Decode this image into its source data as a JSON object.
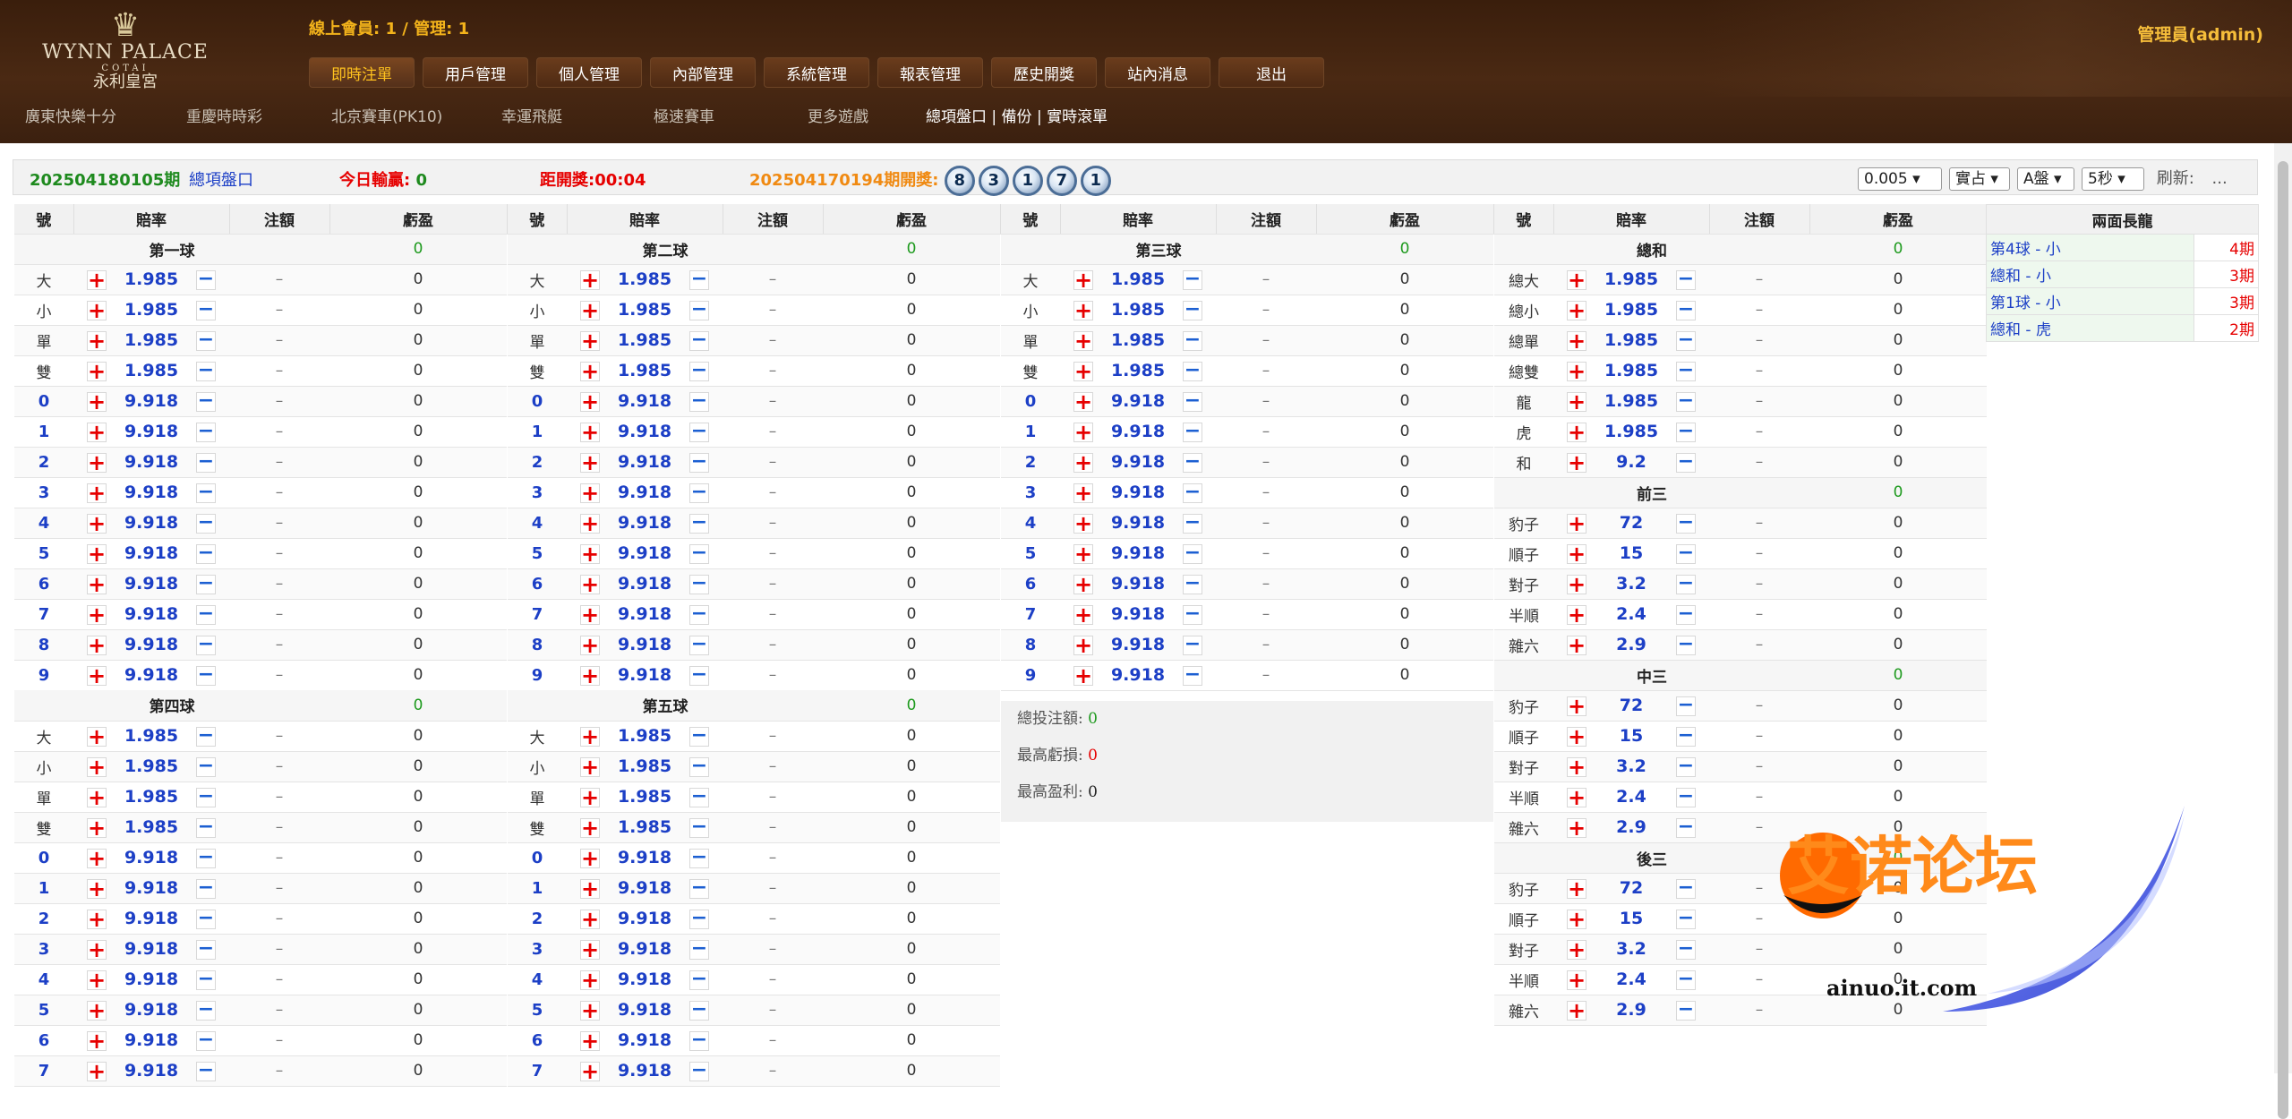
{
  "header": {
    "logo": {
      "name": "WYNN PALACE",
      "sub": "COTAI",
      "cn": "永利皇宮"
    },
    "online_label": "線上會員: ",
    "online_members": "1",
    "sep": " / 管理: ",
    "online_admins": "1",
    "admin": "管理員(admin)",
    "nav": [
      "即時注單",
      "用戶管理",
      "個人管理",
      "內部管理",
      "系統管理",
      "報表管理",
      "歷史開獎",
      "站內消息",
      "退出"
    ],
    "games": [
      "廣東快樂十分",
      "重慶時時彩",
      "北京賽車(PK10)",
      "幸運飛艇",
      "極速賽車",
      "更多遊戲"
    ],
    "sub_links": [
      "總項盤口",
      "備份",
      "實時滾單"
    ]
  },
  "topbar": {
    "period": "202504180105期",
    "panel_link": "總項盤口",
    "profit_label": "今日輸贏:",
    "profit_value": "0",
    "countdown_label": "距開獎:",
    "countdown_value": "00:04",
    "last_period": "202504170194期開獎:",
    "balls": [
      "8",
      "3",
      "1",
      "7",
      "1"
    ],
    "sel_amount": "0.005",
    "sel_type": "實占",
    "sel_panel": "A盤",
    "sel_interval": "5秒",
    "refresh_label": "刷新:",
    "refresh_value": "..."
  },
  "columns": {
    "no": "號",
    "odds": "賠率",
    "bet": "注額",
    "pl": "虧盈"
  },
  "dash": "–",
  "zero": "0",
  "balls_sections": {
    "b1": "第一球",
    "b2": "第二球",
    "b3": "第三球",
    "b4": "第四球",
    "b5": "第五球"
  },
  "ball_rows": [
    {
      "l": "大",
      "o": "1.985",
      "t": "cn"
    },
    {
      "l": "小",
      "o": "1.985",
      "t": "cn"
    },
    {
      "l": "單",
      "o": "1.985",
      "t": "cn"
    },
    {
      "l": "雙",
      "o": "1.985",
      "t": "cn"
    },
    {
      "l": "0",
      "o": "9.918",
      "t": "n"
    },
    {
      "l": "1",
      "o": "9.918",
      "t": "n"
    },
    {
      "l": "2",
      "o": "9.918",
      "t": "n"
    },
    {
      "l": "3",
      "o": "9.918",
      "t": "n"
    },
    {
      "l": "4",
      "o": "9.918",
      "t": "n"
    },
    {
      "l": "5",
      "o": "9.918",
      "t": "n"
    },
    {
      "l": "6",
      "o": "9.918",
      "t": "n"
    },
    {
      "l": "7",
      "o": "9.918",
      "t": "n"
    },
    {
      "l": "8",
      "o": "9.918",
      "t": "n"
    },
    {
      "l": "9",
      "o": "9.918",
      "t": "n"
    }
  ],
  "total": {
    "title": "總和",
    "rows": [
      {
        "l": "總大",
        "o": "1.985"
      },
      {
        "l": "總小",
        "o": "1.985"
      },
      {
        "l": "總單",
        "o": "1.985"
      },
      {
        "l": "總雙",
        "o": "1.985"
      },
      {
        "l": "龍",
        "o": "1.985"
      },
      {
        "l": "虎",
        "o": "1.985"
      },
      {
        "l": "和",
        "o": "9.2"
      }
    ]
  },
  "three_sections": [
    "前三",
    "中三",
    "後三"
  ],
  "three_rows": [
    {
      "l": "豹子",
      "o": "72"
    },
    {
      "l": "順子",
      "o": "15"
    },
    {
      "l": "對子",
      "o": "3.2"
    },
    {
      "l": "半順",
      "o": "2.4"
    },
    {
      "l": "雜六",
      "o": "2.9"
    }
  ],
  "summary": {
    "total_bet_label": "總投注額:",
    "total_bet": "0",
    "max_loss_label": "最高虧損:",
    "max_loss": "0",
    "max_profit_label": "最高盈利:",
    "max_profit": "0"
  },
  "long_dragon": {
    "title": "兩面長龍",
    "rows": [
      {
        "k": "第4球 -  小",
        "v": "4期"
      },
      {
        "k": "總和  -  小",
        "v": "3期"
      },
      {
        "k": "第1球 -  小",
        "v": "3期"
      },
      {
        "k": "總和  -  虎",
        "v": "2期"
      }
    ]
  },
  "watermark": {
    "cn": "艾诺论坛",
    "url": "ainuo.it.com"
  }
}
